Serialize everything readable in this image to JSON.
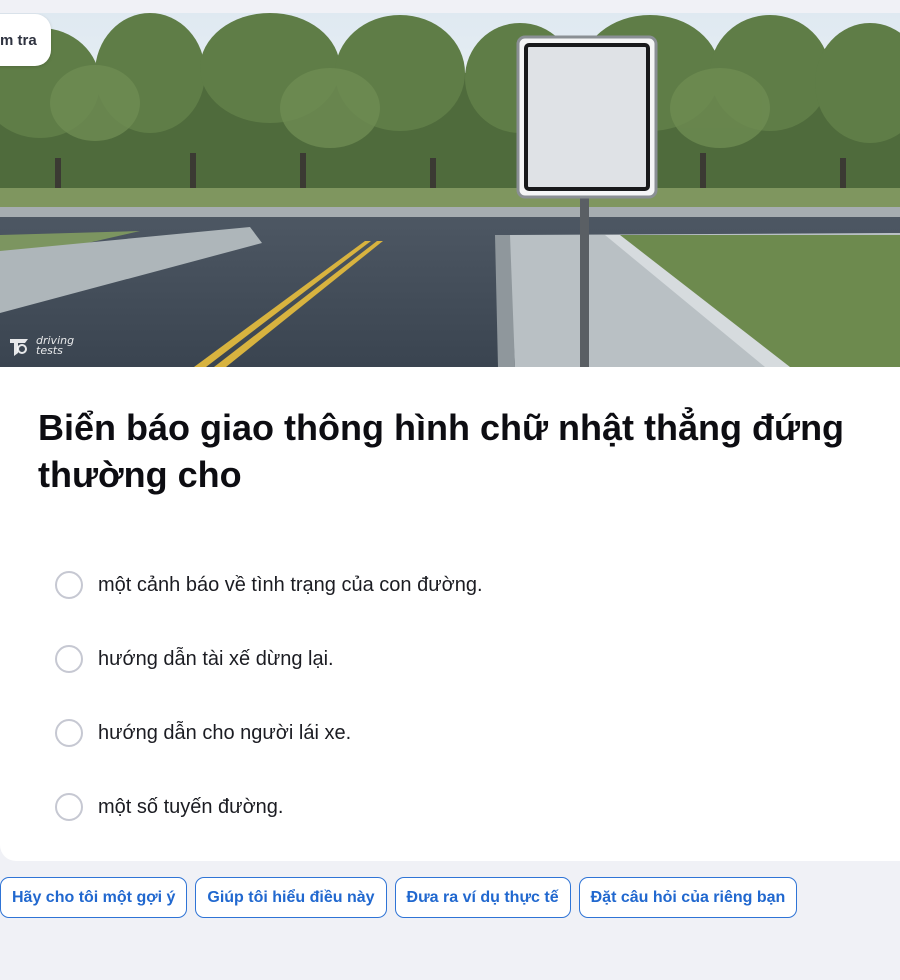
{
  "badge": {
    "label": "m tra"
  },
  "watermark": {
    "line1": "driving",
    "line2": "tests"
  },
  "question": {
    "text": "Biển báo giao thông hình chữ nhật thẳng đứng thường cho"
  },
  "options": [
    {
      "label": "một cảnh báo về tình trạng của con đường."
    },
    {
      "label": "hướng dẫn tài xế dừng lại."
    },
    {
      "label": "hướng dẫn cho người lái xe."
    },
    {
      "label": "một số tuyến đường."
    }
  ],
  "selected_option": null,
  "chips": [
    {
      "label": "Hãy cho tôi một gợi ý"
    },
    {
      "label": "Giúp tôi hiểu điều này"
    },
    {
      "label": "Đưa ra ví dụ thực tế"
    },
    {
      "label": "Đặt câu hỏi của riêng bạn"
    }
  ],
  "colors": {
    "page_background": "#f0f1f6",
    "chip_accent": "#2168cf",
    "radio_border": "#c6c8d2"
  }
}
